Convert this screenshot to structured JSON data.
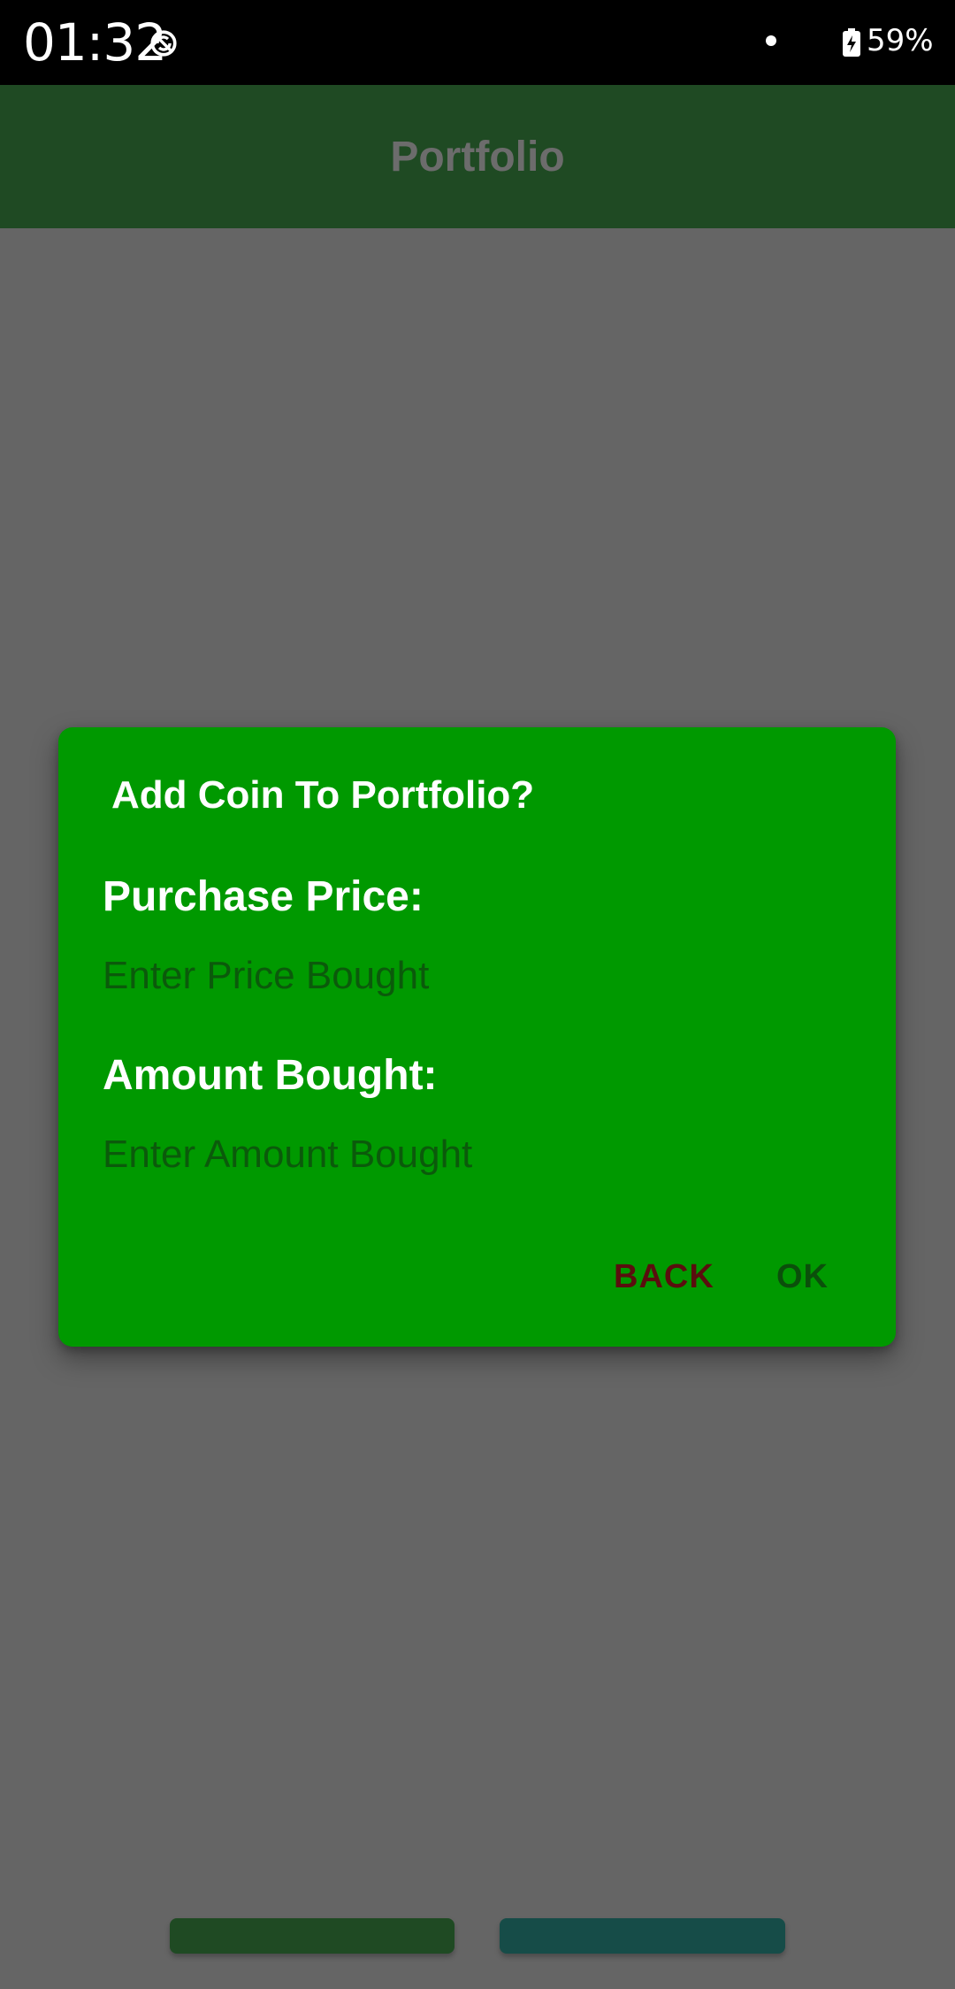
{
  "status_bar": {
    "time": "01:32",
    "battery": "59%"
  },
  "app_bar": {
    "title": "Portfolio"
  },
  "dialog": {
    "title": "Add Coin To Portfolio?",
    "price_label": "Purchase Price:",
    "price_placeholder": "Enter Price Bought",
    "amount_label": "Amount Bought:",
    "amount_placeholder": "Enter Amount Bought",
    "back_label": "BACK",
    "ok_label": "OK"
  },
  "colors": {
    "dialog_bg": "#009900",
    "app_bar_dimmed": "#1f4a23",
    "scrim": "#656565",
    "back_text": "#5a0e0e",
    "ok_text": "#0b4f0b"
  },
  "icons": {
    "sync": "sync-off-icon",
    "battery": "battery-charging-icon"
  }
}
